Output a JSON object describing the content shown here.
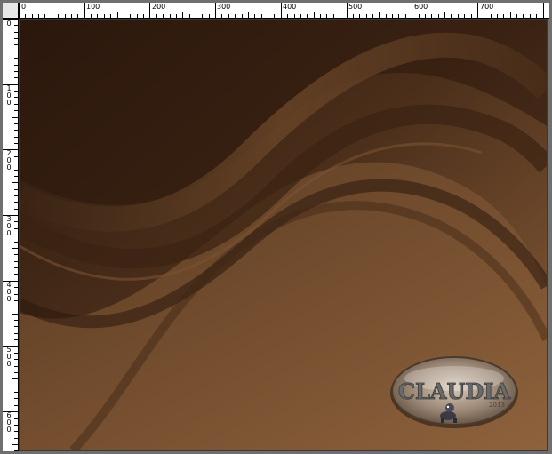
{
  "rulers": {
    "horizontal_labels": [
      "0",
      "100",
      "200",
      "300",
      "400",
      "500",
      "600",
      "700"
    ],
    "vertical_labels": [
      "0",
      "100",
      "200",
      "300",
      "400",
      "500",
      "600"
    ]
  },
  "watermark": {
    "text": "CLAUDIA",
    "subtext": "2013"
  },
  "colors": {
    "dark": "#2a170c",
    "mid": "#5a3a22",
    "light": "#8a5e3a"
  }
}
